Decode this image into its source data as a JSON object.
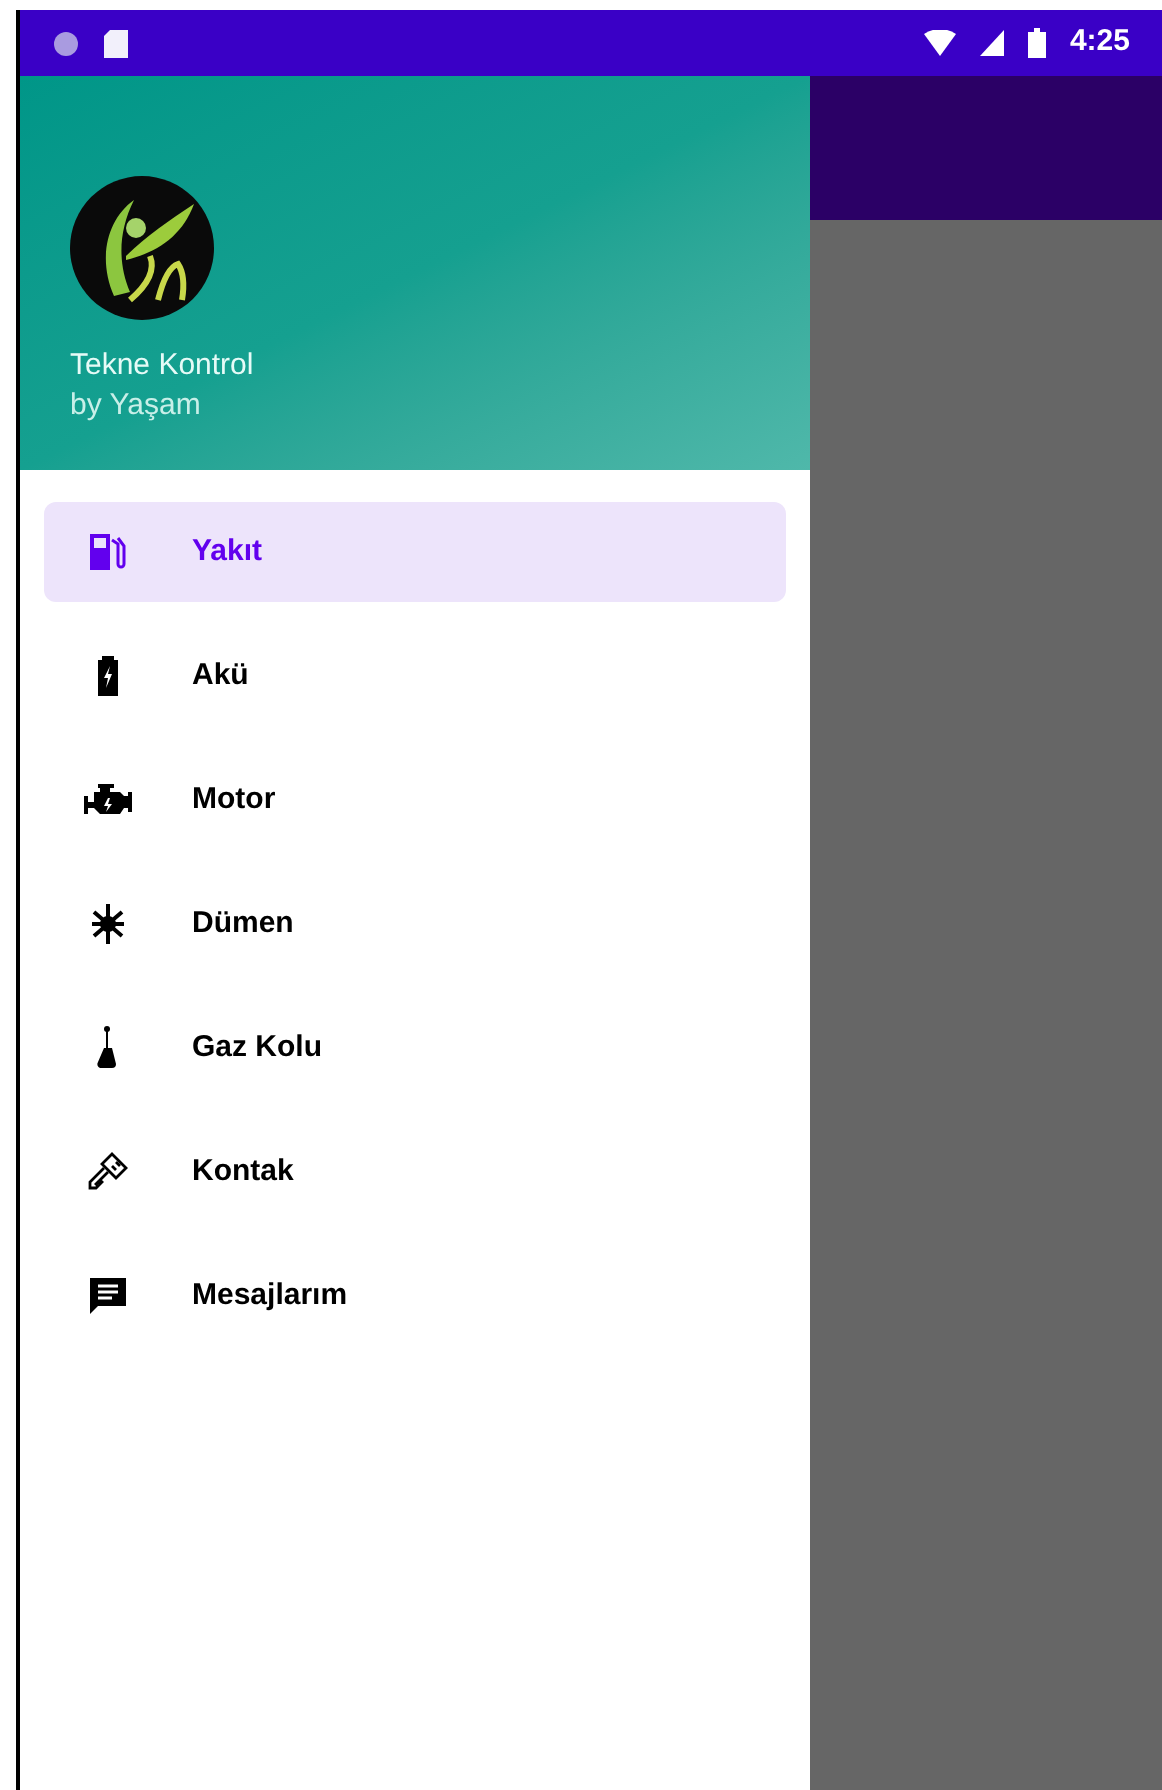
{
  "status_bar": {
    "time": "4:25"
  },
  "drawer": {
    "header": {
      "title": "Tekne Kontrol",
      "subtitle": "by Yaşam"
    },
    "items": [
      {
        "label": "Yakıt",
        "kind": "fuel",
        "selected": true
      },
      {
        "label": "Akü",
        "kind": "battery",
        "selected": false
      },
      {
        "label": "Motor",
        "kind": "engine",
        "selected": false
      },
      {
        "label": "Dümen",
        "kind": "rudder",
        "selected": false
      },
      {
        "label": "Gaz Kolu",
        "kind": "throttle",
        "selected": false
      },
      {
        "label": "Kontak",
        "kind": "key",
        "selected": false
      },
      {
        "label": "Mesajlarım",
        "kind": "message",
        "selected": false
      }
    ]
  }
}
